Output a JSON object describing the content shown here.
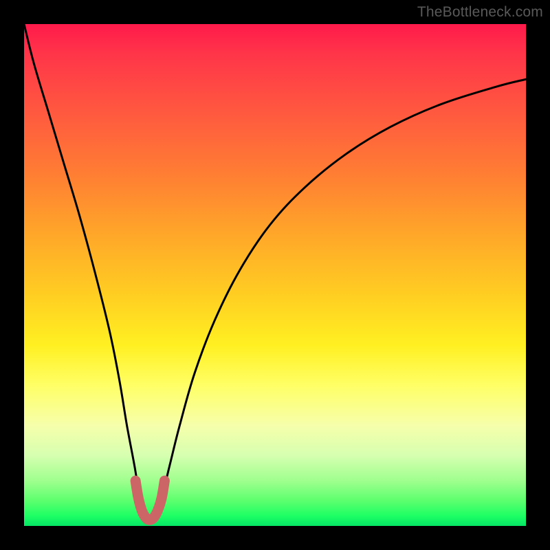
{
  "watermark": "TheBottleneck.com",
  "colors": {
    "frame": "#000000",
    "curve_main": "#000000",
    "curve_highlight": "#cc6666",
    "gradient_top": "#ff1a4b",
    "gradient_bottom": "#06e565"
  },
  "chart_data": {
    "type": "line",
    "title": "",
    "xlabel": "",
    "ylabel": "",
    "xlim": [
      0,
      100
    ],
    "ylim": [
      0,
      100
    ],
    "grid": false,
    "legend": false,
    "series": [
      {
        "name": "bottleneck-curve",
        "x": [
          0,
          2,
          5,
          8,
          11,
          14,
          17,
          19,
          20.5,
          22,
          23,
          24,
          25,
          26,
          27.5,
          29,
          31,
          34,
          38,
          43,
          49,
          56,
          64,
          73,
          83,
          94,
          100
        ],
        "y": [
          100,
          92,
          82,
          72,
          62,
          51,
          39,
          29,
          20,
          12,
          6,
          2,
          0.5,
          2,
          6,
          12,
          20,
          30.5,
          41,
          51,
          60,
          67.5,
          74,
          79.5,
          84,
          87.5,
          89
        ]
      },
      {
        "name": "optimum-zone",
        "x": [
          22.2,
          22.8,
          23.5,
          24.3,
          25.0,
          25.8,
          26.6,
          27.4,
          28.0
        ],
        "y": [
          9.0,
          5.5,
          3.0,
          1.6,
          1.2,
          1.6,
          3.0,
          5.5,
          9.0
        ]
      }
    ],
    "annotations": []
  }
}
